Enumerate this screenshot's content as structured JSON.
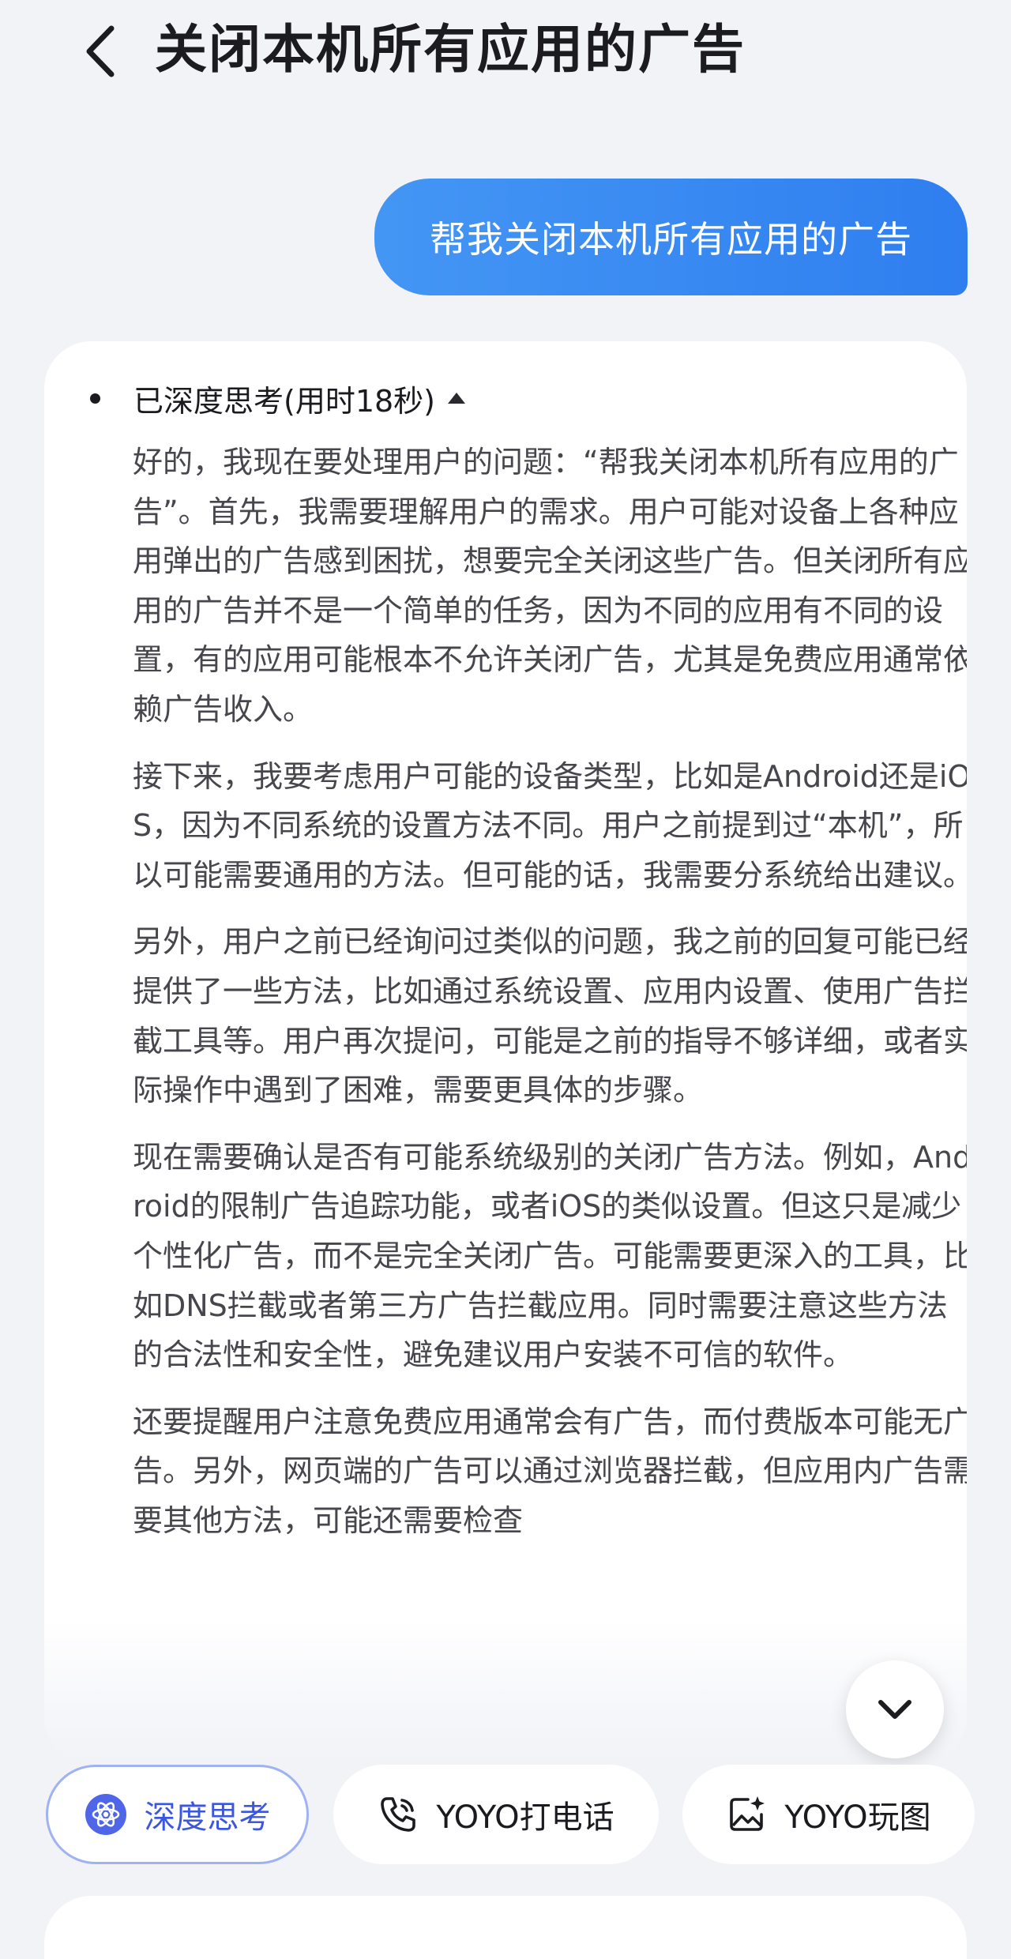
{
  "header": {
    "title": "关闭本机所有应用的广告",
    "back_icon": "chevron-left-icon"
  },
  "user_message": {
    "text": "帮我关闭本机所有应用的广告"
  },
  "thinking": {
    "label": "已深度思考(用时18秒)",
    "expanded": true,
    "paragraphs": [
      "好的，我现在要处理用户的问题：“帮我关闭本机所有应用的广告”。首先，我需要理解用户的需求。用户可能对设备上各种应用弹出的广告感到困扰，想要完全关闭这些广告。但关闭所有应用的广告并不是一个简单的任务，因为不同的应用有不同的设置，有的应用可能根本不允许关闭广告，尤其是免费应用通常依赖广告收入。",
      "接下来，我要考虑用户可能的设备类型，比如是Android还是iOS，因为不同系统的设置方法不同。用户之前提到过“本机”，所以可能需要通用的方法。但可能的话，我需要分系统给出建议。",
      "另外，用户之前已经询问过类似的问题，我之前的回复可能已经提供了一些方法，比如通过系统设置、应用内设置、使用广告拦截工具等。用户再次提问，可能是之前的指导不够详细，或者实际操作中遇到了困难，需要更具体的步骤。",
      "现在需要确认是否有可能系统级别的关闭广告方法。例如，Android的限制广告追踪功能，或者iOS的类似设置。但这只是减少个性化广告，而不是完全关闭广告。可能需要更深入的工具，比如DNS拦截或者第三方广告拦截应用。同时需要注意这些方法的合法性和安全性，避免建议用户安装不可信的软件。",
      "还要提醒用户注意免费应用通常会有广告，而付费版本可能无广告。另外，网页端的广告可以通过浏览器拦截，但应用内广告需要其他方法，可能还需要检查"
    ]
  },
  "scroll_down": {
    "icon": "chevron-down-icon"
  },
  "chips": [
    {
      "label": "深度思考",
      "icon": "atom-icon",
      "active": true
    },
    {
      "label": "YOYO打电话",
      "icon": "phone-call-icon",
      "active": false
    },
    {
      "label": "YOYO玩图",
      "icon": "image-sparkle-icon",
      "active": false
    }
  ],
  "colors": {
    "background": "#f2f3f7",
    "bubble": "#3a8af2",
    "accent": "#3b56e0"
  }
}
